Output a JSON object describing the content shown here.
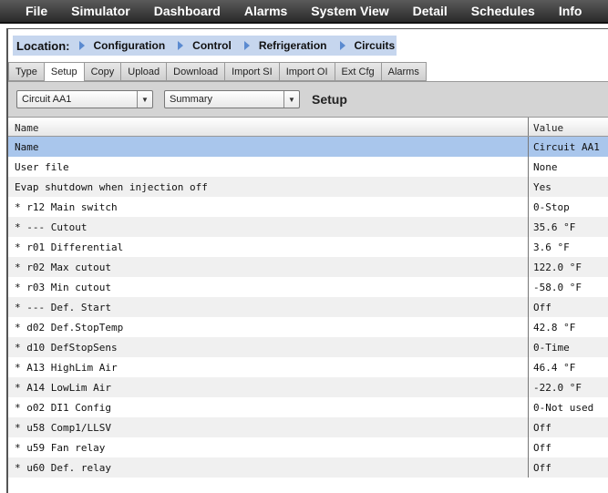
{
  "menu": [
    "File",
    "Simulator",
    "Dashboard",
    "Alarms",
    "System View",
    "Detail",
    "Schedules",
    "Info"
  ],
  "location": {
    "label": "Location:",
    "crumbs": [
      "Configuration",
      "Control",
      "Refrigeration",
      "Circuits"
    ]
  },
  "tabs": [
    "Type",
    "Setup",
    "Copy",
    "Upload",
    "Download",
    "Import SI",
    "Import OI",
    "Ext Cfg",
    "Alarms"
  ],
  "active_tab": "Setup",
  "toolbar": {
    "circuit": "Circuit AA1",
    "view": "Summary",
    "title": "Setup"
  },
  "table": {
    "headers": [
      "Name",
      "Value"
    ],
    "rows": [
      [
        "Name",
        "Circuit AA1"
      ],
      [
        "User file",
        "None"
      ],
      [
        "Evap shutdown when injection off",
        "Yes"
      ],
      [
        "* r12 Main switch",
        "0-Stop"
      ],
      [
        "* --- Cutout",
        "35.6 °F"
      ],
      [
        "* r01 Differential",
        "3.6 °F"
      ],
      [
        "* r02 Max cutout",
        "122.0 °F"
      ],
      [
        "* r03 Min cutout",
        "-58.0 °F"
      ],
      [
        "* --- Def. Start",
        "Off"
      ],
      [
        "* d02 Def.StopTemp",
        "42.8 °F"
      ],
      [
        "* d10 DefStopSens",
        "0-Time"
      ],
      [
        "* A13 HighLim Air",
        "46.4 °F"
      ],
      [
        "* A14 LowLim Air",
        "-22.0 °F"
      ],
      [
        "* o02 DI1 Config",
        "0-Not used"
      ],
      [
        "* u58 Comp1/LLSV",
        "Off"
      ],
      [
        "* u59 Fan relay",
        "Off"
      ],
      [
        "* u60 Def. relay",
        "Off"
      ]
    ]
  }
}
